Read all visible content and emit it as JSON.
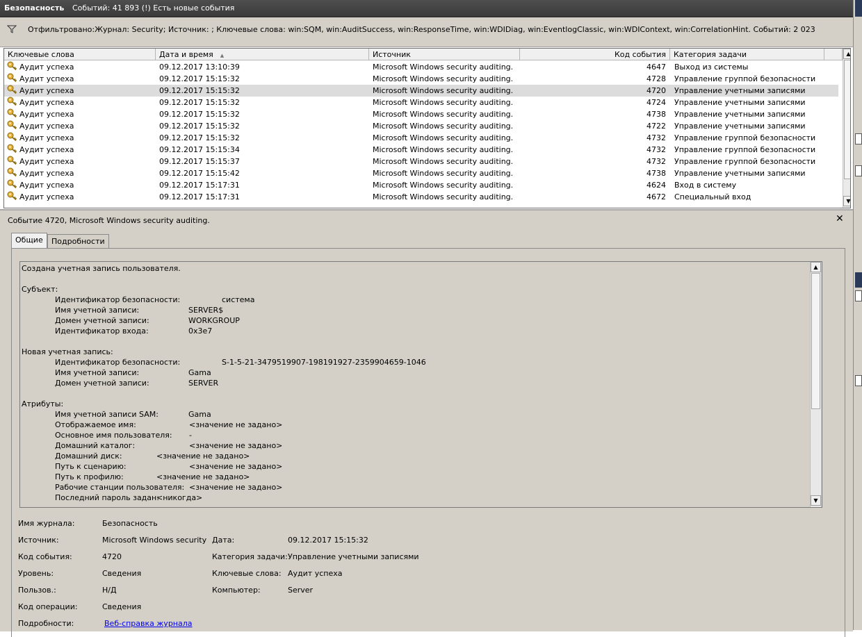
{
  "window": {
    "title": "Безопасность",
    "events_info": "Событий: 41 893 (!) Есть новые события"
  },
  "filter": {
    "text": "Отфильтровано:Журнал: Security; Источник: ; Ключевые слова: win:SQM, win:AuditSuccess, win:ResponseTime, win:WDIDiag, win:EventlogClassic, win:WDIContext, win:CorrelationHint. Событий: 2 023"
  },
  "grid": {
    "columns": [
      "Ключевые слова",
      "Дата и время",
      "Источник",
      "Код события",
      "Категория задачи"
    ],
    "sort_indicator": "▲",
    "rows": [
      {
        "keyword": "Аудит успеха",
        "datetime": "09.12.2017 13:10:39",
        "source": "Microsoft Windows security auditing.",
        "event_id": "4647",
        "category": "Выход из системы",
        "selected": false
      },
      {
        "keyword": "Аудит успеха",
        "datetime": "09.12.2017 15:15:32",
        "source": "Microsoft Windows security auditing.",
        "event_id": "4728",
        "category": "Управление группой безопасности",
        "selected": false
      },
      {
        "keyword": "Аудит успеха",
        "datetime": "09.12.2017 15:15:32",
        "source": "Microsoft Windows security auditing.",
        "event_id": "4720",
        "category": "Управление учетными записями",
        "selected": true
      },
      {
        "keyword": "Аудит успеха",
        "datetime": "09.12.2017 15:15:32",
        "source": "Microsoft Windows security auditing.",
        "event_id": "4724",
        "category": "Управление учетными записями",
        "selected": false
      },
      {
        "keyword": "Аудит успеха",
        "datetime": "09.12.2017 15:15:32",
        "source": "Microsoft Windows security auditing.",
        "event_id": "4738",
        "category": "Управление учетными записями",
        "selected": false
      },
      {
        "keyword": "Аудит успеха",
        "datetime": "09.12.2017 15:15:32",
        "source": "Microsoft Windows security auditing.",
        "event_id": "4722",
        "category": "Управление учетными записями",
        "selected": false
      },
      {
        "keyword": "Аудит успеха",
        "datetime": "09.12.2017 15:15:32",
        "source": "Microsoft Windows security auditing.",
        "event_id": "4732",
        "category": "Управление группой безопасности",
        "selected": false
      },
      {
        "keyword": "Аудит успеха",
        "datetime": "09.12.2017 15:15:34",
        "source": "Microsoft Windows security auditing.",
        "event_id": "4732",
        "category": "Управление группой безопасности",
        "selected": false
      },
      {
        "keyword": "Аудит успеха",
        "datetime": "09.12.2017 15:15:37",
        "source": "Microsoft Windows security auditing.",
        "event_id": "4732",
        "category": "Управление группой безопасности",
        "selected": false
      },
      {
        "keyword": "Аудит успеха",
        "datetime": "09.12.2017 15:15:42",
        "source": "Microsoft Windows security auditing.",
        "event_id": "4738",
        "category": "Управление учетными записями",
        "selected": false
      },
      {
        "keyword": "Аудит успеха",
        "datetime": "09.12.2017 15:17:31",
        "source": "Microsoft Windows security auditing.",
        "event_id": "4624",
        "category": "Вход в систему",
        "selected": false
      },
      {
        "keyword": "Аудит успеха",
        "datetime": "09.12.2017 15:17:31",
        "source": "Microsoft Windows security auditing.",
        "event_id": "4672",
        "category": "Специальный вход",
        "selected": false
      }
    ]
  },
  "details": {
    "title": "Событие 4720, Microsoft Windows security auditing.",
    "close": "✕",
    "tabs": [
      "Общие",
      "Подробности"
    ],
    "message": {
      "header": "Создана учетная запись пользователя.",
      "subject_label": "Субъект:",
      "subject": [
        {
          "k": "Идентификатор безопасности:",
          "v": "система"
        },
        {
          "k": "Имя учетной записи:",
          "v": "SERVER$"
        },
        {
          "k": "Домен учетной записи:",
          "v": "WORKGROUP"
        },
        {
          "k": "Идентификатор входа:",
          "v": "0x3e7"
        }
      ],
      "new_account_label": "Новая учетная запись:",
      "new_account": [
        {
          "k": "Идентификатор безопасности:",
          "v": "S-1-5-21-3479519907-198191927-2359904659-1046"
        },
        {
          "k": "Имя учетной записи:",
          "v": "Gama"
        },
        {
          "k": "Домен учетной записи:",
          "v": "SERVER"
        }
      ],
      "attributes_label": "Атрибуты:",
      "attributes": [
        {
          "k": "Имя учетной записи SAM:",
          "v": "Gama"
        },
        {
          "k": "Отображаемое имя:",
          "v": "<значение не задано>"
        },
        {
          "k": "Основное имя пользователя:",
          "v": "-"
        },
        {
          "k": "Домашний каталог:",
          "v": "<значение не задано>"
        },
        {
          "k": "Домашний диск:",
          "v": "<значение не задано>"
        },
        {
          "k": "Путь к сценарию:",
          "v": "<значение не задано>"
        },
        {
          "k": "Путь к профилю:",
          "v": "<значение не задано>"
        },
        {
          "k": "Рабочие станции пользователя:",
          "v": "<значение не задано>"
        },
        {
          "k": "Последний пароль задан:",
          "v": "<никогда>"
        }
      ]
    },
    "props": {
      "log_name_label": "Имя журнала:",
      "log_name": "Безопасность",
      "source_label": "Источник:",
      "source": "Microsoft Windows security",
      "date_label": "Дата:",
      "date": "09.12.2017 15:15:32",
      "event_id_label": "Код события:",
      "event_id": "4720",
      "task_category_label": "Категория задачи:",
      "task_category": "Управление учетными записями",
      "level_label": "Уровень:",
      "level": "Сведения",
      "keywords_label": "Ключевые слова:",
      "keywords": "Аудит успеха",
      "user_label": "Пользов.:",
      "user": "Н/Д",
      "computer_label": "Компьютер:",
      "computer": "Server",
      "opcode_label": "Код операции:",
      "opcode": "Сведения",
      "more_info_label": "Подробности:",
      "more_info_link": "Веб-справка журнала"
    }
  }
}
